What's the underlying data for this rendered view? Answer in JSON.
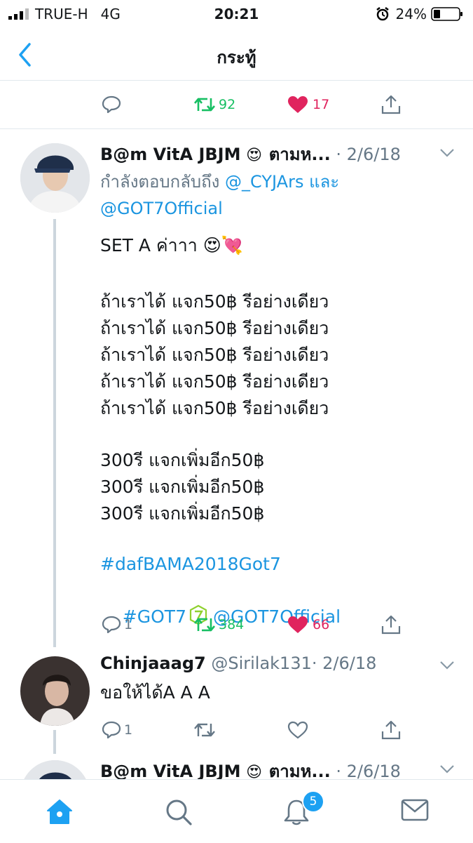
{
  "status": {
    "carrier": "TRUE-H",
    "network": "4G",
    "time": "20:21",
    "battery": "24%"
  },
  "nav": {
    "title": "กระทู้"
  },
  "top_actions": {
    "retweets": "92",
    "likes": "17"
  },
  "tweet1": {
    "name": "B@m VitA JBJM",
    "handle": "ตามห...",
    "date": "· 2/6/18",
    "reply_prefix": "กำลังตอบกลับถึง ",
    "reply_user1": "@_CYJArs",
    "reply_and": " และ",
    "reply_user2": "@GOT7Official",
    "line1": "SET A ค่าาา",
    "give_lines": [
      "ถ้าเราได้ แจก50฿ รีอย่างเดียว",
      "ถ้าเราได้ แจก50฿ รีอย่างเดียว",
      "ถ้าเราได้ แจก50฿ รีอย่างเดียว",
      "ถ้าเราได้ แจก50฿ รีอย่างเดียว",
      "ถ้าเราได้ แจก50฿ รีอย่างเดียว"
    ],
    "rt_lines": [
      "300รี แจกเพิ่มอีก50฿",
      "300รี แจกเพิ่มอีก50฿",
      "300รี แจกเพิ่มอีก50฿"
    ],
    "hashtag1": "#dafBAMA2018Got7",
    "hashtag2": "#GOT7",
    "mention": "@GOT7Official",
    "replies": "1",
    "retweets": "384",
    "likes": "66"
  },
  "tweet2": {
    "name": "Chinjaaag7",
    "handle": "@Sirilak131",
    "date": "· 2/6/18",
    "text": "ขอให้ได้A A A",
    "replies": "1"
  },
  "tweet3": {
    "name": "B@m VitA JBJM",
    "handle": "ตามห...",
    "date": "· 2/6/18"
  },
  "tabs": {
    "notifications_badge": "5"
  },
  "icons": [
    "signal-icon",
    "alarm-icon",
    "battery-icon",
    "back-arrow-icon",
    "reply-icon",
    "retweet-icon",
    "like-icon",
    "share-icon",
    "chevron-down-icon",
    "home-icon",
    "search-icon",
    "bell-icon",
    "mail-icon"
  ],
  "colors": {
    "accent": "#1da1f2",
    "link": "#1b95e0",
    "retweet": "#17bf63",
    "like": "#e0245e",
    "muted": "#657786"
  }
}
